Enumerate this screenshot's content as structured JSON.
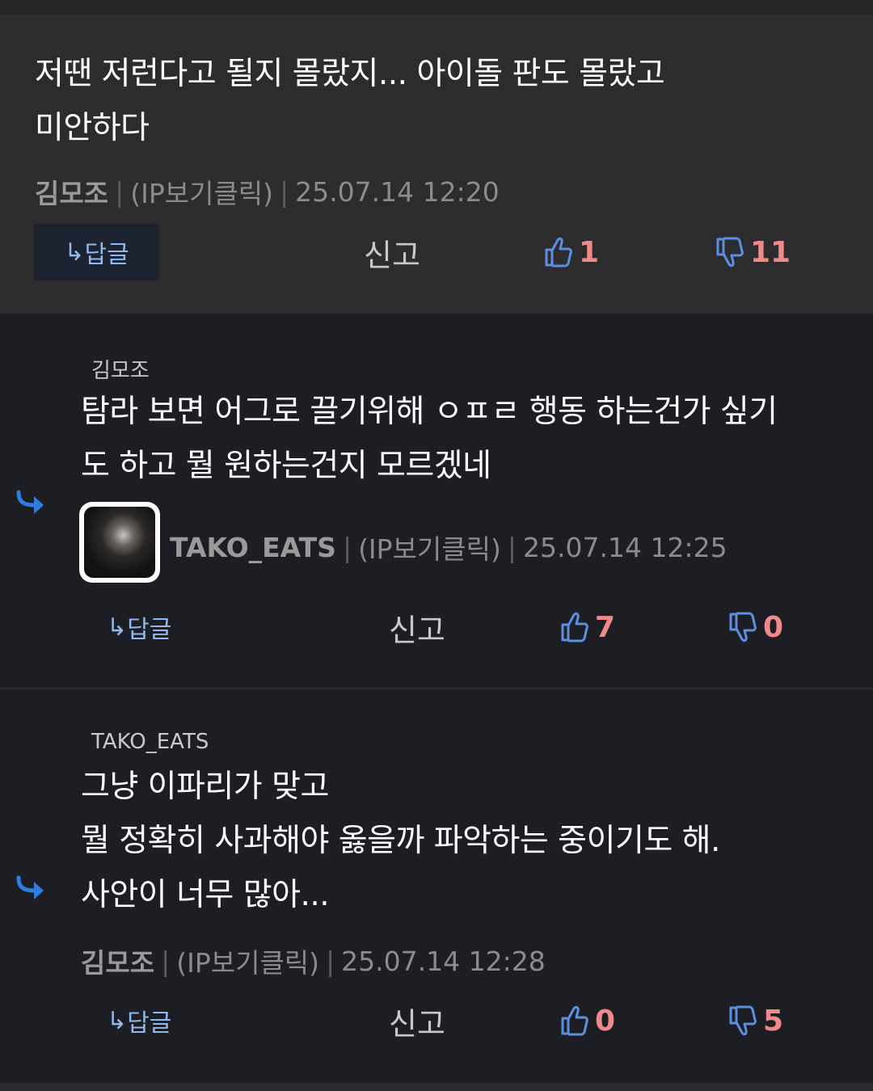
{
  "comments": [
    {
      "reply_to": "",
      "text": "저땐 저런다고 될지 몰랐지... 아이돌 판도 몰랐고\n미안하다",
      "author": "김모조",
      "ip_link": "(IP보기클릭)",
      "timestamp": "25.07.14 12:20",
      "reply_label": "답글",
      "report_label": "신고",
      "upvotes": "1",
      "downvotes": "11"
    },
    {
      "reply_to": "김모조",
      "text": "탐라 보면 어그로 끌기위해 ㅇㅍㄹ 행동 하는건가 싶기\n도 하고 뭘 원하는건지 모르겠네",
      "author": "TAKO_EATS",
      "ip_link": "(IP보기클릭)",
      "timestamp": "25.07.14 12:25",
      "reply_label": "답글",
      "report_label": "신고",
      "upvotes": "7",
      "downvotes": "0"
    },
    {
      "reply_to": "TAKO_EATS",
      "text": "그냥 이파리가 맞고\n뭘 정확히 사과해야 옳을까 파악하는 중이기도 해.\n사안이 너무 많아...",
      "author": "김모조",
      "ip_link": "(IP보기클릭)",
      "timestamp": "25.07.14 12:28",
      "reply_label": "답글",
      "report_label": "신고",
      "upvotes": "0",
      "downvotes": "5"
    }
  ],
  "separator": "|",
  "colors": {
    "reply_blue": "#8fb8ee",
    "vote_red": "#ef8a8a",
    "thumb_blue": "#5b8fe0",
    "arrow_blue": "#2f7ce0"
  }
}
